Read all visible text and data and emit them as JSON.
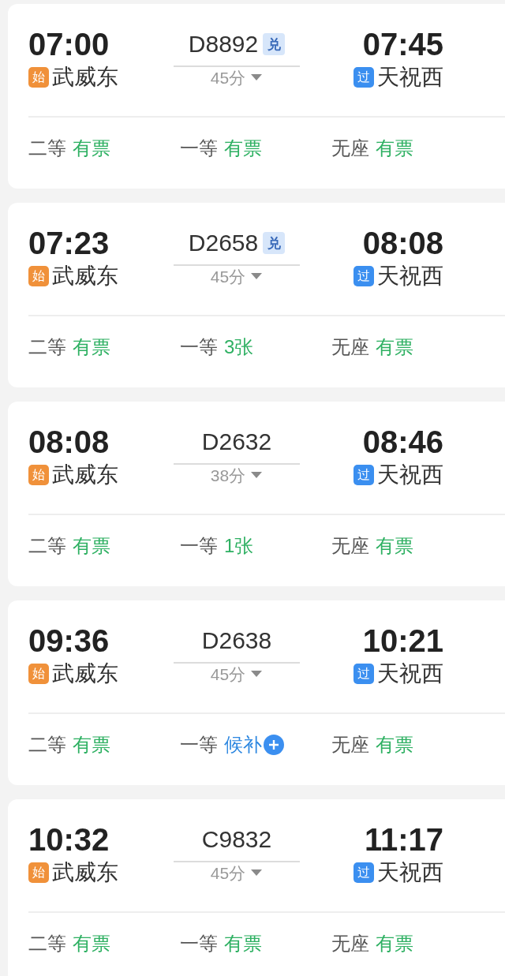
{
  "trains": [
    {
      "depart": "07:00",
      "from": {
        "badge": "始",
        "kind": "start",
        "name": "武威东"
      },
      "number": "D8892",
      "exchange": "兑",
      "duration": "45分",
      "arrive": "07:45",
      "to": {
        "badge": "过",
        "kind": "pass",
        "name": "天祝西"
      },
      "seats": [
        {
          "class": "二等",
          "status": "有票",
          "kind": "available"
        },
        {
          "class": "一等",
          "status": "有票",
          "kind": "available"
        },
        {
          "class": "无座",
          "status": "有票",
          "kind": "available"
        }
      ]
    },
    {
      "depart": "07:23",
      "from": {
        "badge": "始",
        "kind": "start",
        "name": "武威东"
      },
      "number": "D2658",
      "exchange": "兑",
      "duration": "45分",
      "arrive": "08:08",
      "to": {
        "badge": "过",
        "kind": "pass",
        "name": "天祝西"
      },
      "seats": [
        {
          "class": "二等",
          "status": "有票",
          "kind": "available"
        },
        {
          "class": "一等",
          "status": "3张",
          "kind": "available"
        },
        {
          "class": "无座",
          "status": "有票",
          "kind": "available"
        }
      ]
    },
    {
      "depart": "08:08",
      "from": {
        "badge": "始",
        "kind": "start",
        "name": "武威东"
      },
      "number": "D2632",
      "duration": "38分",
      "arrive": "08:46",
      "to": {
        "badge": "过",
        "kind": "pass",
        "name": "天祝西"
      },
      "seats": [
        {
          "class": "二等",
          "status": "有票",
          "kind": "available"
        },
        {
          "class": "一等",
          "status": "1张",
          "kind": "available"
        },
        {
          "class": "无座",
          "status": "有票",
          "kind": "available"
        }
      ]
    },
    {
      "depart": "09:36",
      "from": {
        "badge": "始",
        "kind": "start",
        "name": "武威东"
      },
      "number": "D2638",
      "duration": "45分",
      "arrive": "10:21",
      "to": {
        "badge": "过",
        "kind": "pass",
        "name": "天祝西"
      },
      "seats": [
        {
          "class": "二等",
          "status": "有票",
          "kind": "available"
        },
        {
          "class": "一等",
          "status": "候补",
          "kind": "waitlist"
        },
        {
          "class": "无座",
          "status": "有票",
          "kind": "available"
        }
      ]
    },
    {
      "depart": "10:32",
      "from": {
        "badge": "始",
        "kind": "start",
        "name": "武威东"
      },
      "number": "C9832",
      "duration": "45分",
      "arrive": "11:17",
      "to": {
        "badge": "过",
        "kind": "pass",
        "name": "天祝西"
      },
      "seats": [
        {
          "class": "二等",
          "status": "有票",
          "kind": "available"
        },
        {
          "class": "一等",
          "status": "有票",
          "kind": "available"
        },
        {
          "class": "无座",
          "status": "有票",
          "kind": "available"
        }
      ]
    }
  ]
}
